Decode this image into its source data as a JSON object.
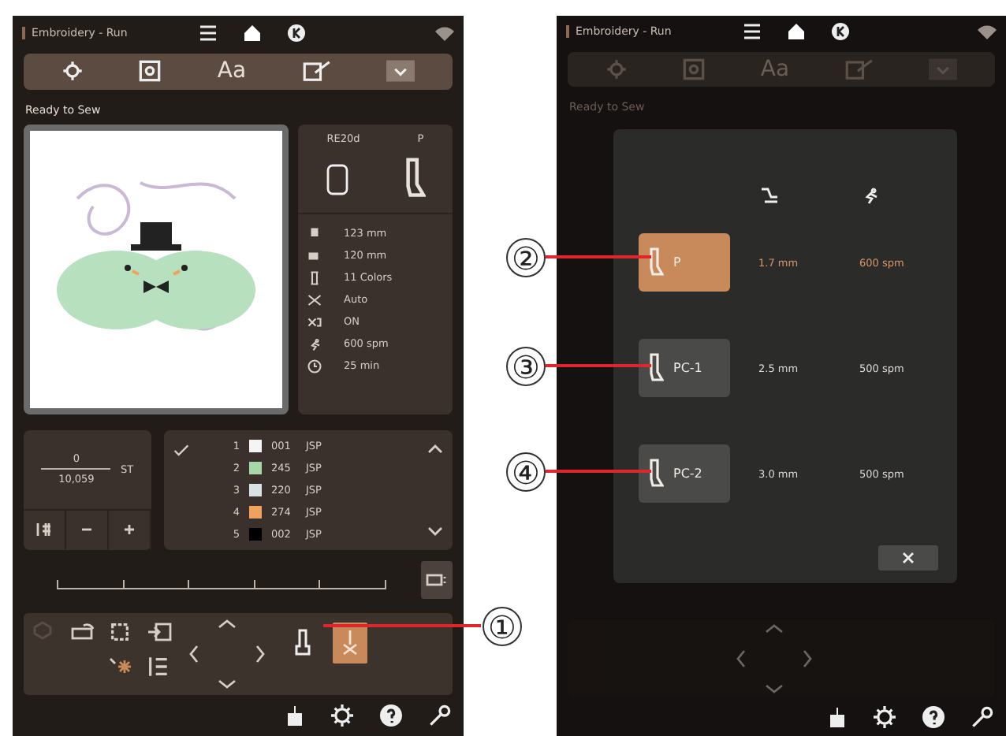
{
  "left_screen": {
    "header": {
      "title": "Embroidery - Run"
    },
    "toolbar": {
      "text_tab": "Aa"
    },
    "status": "Ready to Sew",
    "info": {
      "hoop": "RE20d",
      "foot": "P",
      "stats": [
        {
          "kind": "width",
          "value": "123 mm"
        },
        {
          "kind": "height",
          "value": "120 mm"
        },
        {
          "kind": "colors",
          "value": "11 Colors"
        },
        {
          "kind": "cut",
          "value": "Auto"
        },
        {
          "kind": "trim",
          "value": "ON"
        },
        {
          "kind": "speed",
          "value": "600 spm"
        },
        {
          "kind": "time",
          "value": "25 min"
        }
      ]
    },
    "stitch_counter": {
      "current": "0",
      "total": "10,059",
      "unit": "ST"
    },
    "color_list": [
      {
        "index": "1",
        "code": "001",
        "brand": "JSP",
        "color": "#f4f4f4"
      },
      {
        "index": "2",
        "code": "245",
        "brand": "JSP",
        "color": "#a9d6a6"
      },
      {
        "index": "3",
        "code": "220",
        "brand": "JSP",
        "color": "#d9e2e4"
      },
      {
        "index": "4",
        "code": "274",
        "brand": "JSP",
        "color": "#f0a15e"
      },
      {
        "index": "5",
        "code": "002",
        "brand": "JSP",
        "color": "#000000"
      }
    ],
    "control_buttons": [
      {
        "kind": "foot",
        "selected": false
      },
      {
        "kind": "needle",
        "selected": true
      }
    ]
  },
  "right_screen": {
    "header": {
      "title": "Embroidery - Run"
    },
    "toolbar": {
      "text_tab": "Aa"
    },
    "status": "Ready to Sew",
    "dialog": {
      "feet": [
        {
          "label": "P",
          "height": "1.7 mm",
          "speed": "600 spm",
          "selected": true
        },
        {
          "label": "PC-1",
          "height": "2.5 mm",
          "speed": "500 spm",
          "selected": false
        },
        {
          "label": "PC-2",
          "height": "3.0 mm",
          "speed": "500 spm",
          "selected": false
        }
      ]
    }
  },
  "callouts": [
    {
      "label": "①"
    },
    {
      "label": "②"
    },
    {
      "label": "③"
    },
    {
      "label": "④"
    }
  ]
}
